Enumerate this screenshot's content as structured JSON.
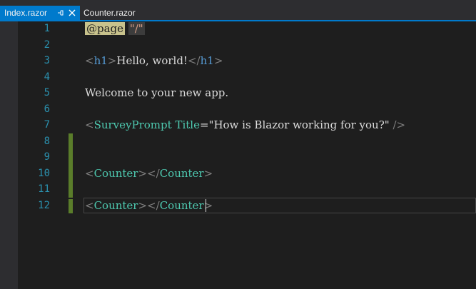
{
  "tabs": [
    {
      "label": "Index.razor",
      "active": true
    },
    {
      "label": "Counter.razor",
      "active": false
    }
  ],
  "line_numbers": [
    "1",
    "2",
    "3",
    "4",
    "5",
    "6",
    "7",
    "8",
    "9",
    "10",
    "11",
    "12"
  ],
  "code": {
    "line1": {
      "directive": "@page",
      "route": "\"/\""
    },
    "line3": {
      "open_tag": "h1",
      "text": "Hello, world!",
      "close_tag": "h1"
    },
    "line5": {
      "text": "Welcome to your new app."
    },
    "line7": {
      "component": "SurveyPrompt",
      "attr": "Title",
      "value": "\"How is Blazor working for you?\""
    },
    "line10": {
      "component": "Counter"
    },
    "line12": {
      "component": "Counter"
    }
  },
  "colors": {
    "tab_active": "#007acc",
    "editor_bg": "#1e1e1e",
    "line_number": "#2b91af",
    "change_bar": "#5a7d2a"
  },
  "icons": [
    "pin-icon",
    "close-icon"
  ]
}
